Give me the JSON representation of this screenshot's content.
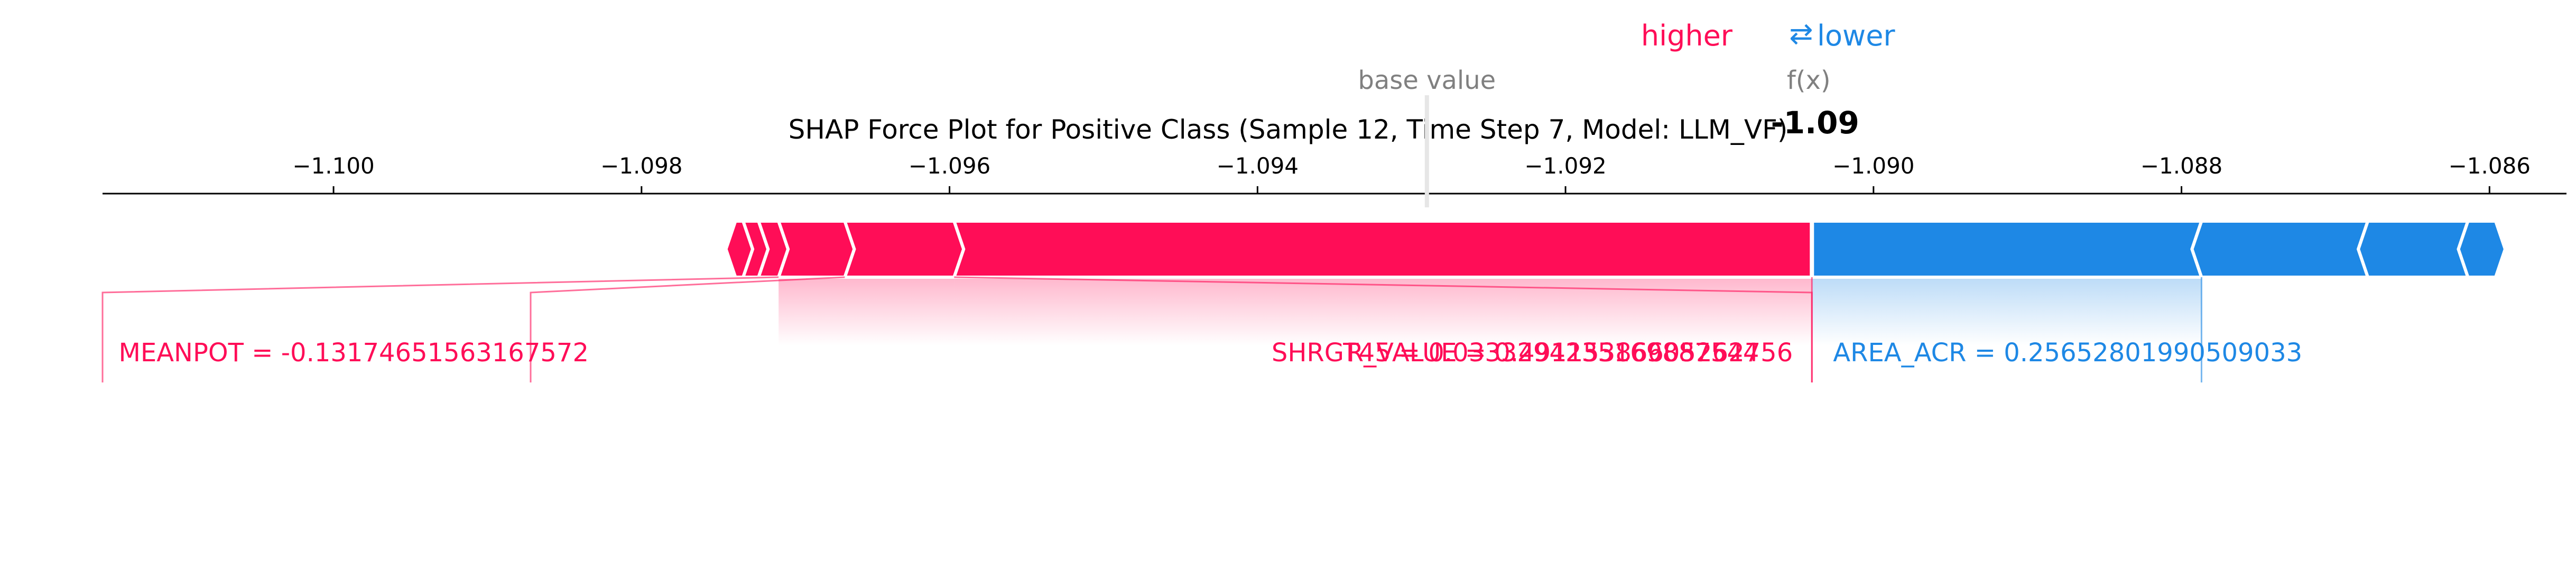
{
  "chart_data": {
    "type": "force",
    "title": "SHAP Force Plot for Positive Class (Sample 12, Time Step 7, Model: LLM_VF)",
    "legend": {
      "higher": "higher",
      "arrows": "⇄",
      "lower": "lower"
    },
    "base_value_label": "base value",
    "fx_label": "f(x)",
    "fx_value_text": "-1.09",
    "base_value": -1.0929,
    "output_value": -1.0904,
    "xlim": [
      -1.1015,
      -1.0855
    ],
    "ticks": [
      {
        "value": -1.1,
        "label": "−1.100"
      },
      {
        "value": -1.098,
        "label": "−1.098"
      },
      {
        "value": -1.096,
        "label": "−1.096"
      },
      {
        "value": -1.094,
        "label": "−1.094"
      },
      {
        "value": -1.092,
        "label": "−1.092"
      },
      {
        "value": -1.09,
        "label": "−1.090"
      },
      {
        "value": -1.088,
        "label": "−1.088"
      },
      {
        "value": -1.086,
        "label": "−1.086"
      }
    ],
    "positive_boundaries": [
      -1.09739,
      -1.09734,
      -1.09724,
      -1.09711,
      -1.09668,
      -1.09597,
      -1.0904
    ],
    "negative_boundaries": [
      -1.0904,
      -1.08787,
      -1.08679,
      -1.08614,
      -1.08596
    ],
    "positive_labels": [
      {
        "text": "SHRGT45 = 0.0333294235169887544",
        "from": -1.09668,
        "to": -1.09597
      },
      {
        "text": "MEANPOT = -0.13174651563167572",
        "from": -1.09711,
        "to": -1.09668
      },
      {
        "text": "R_VALUE = 0.49115386605262756",
        "from": -1.09597,
        "to": -1.0904
      }
    ],
    "negative_labels": [
      {
        "text": "AREA_ACR = 0.25652801990509033",
        "from": -1.0904,
        "to": -1.08787
      }
    ],
    "colors": {
      "positive": "#ff0d57",
      "negative": "#1e88e5",
      "positive_light": "#ffc3d5",
      "negative_light": "#d1e6fa",
      "text": "#000000",
      "muted": "#808080"
    }
  }
}
